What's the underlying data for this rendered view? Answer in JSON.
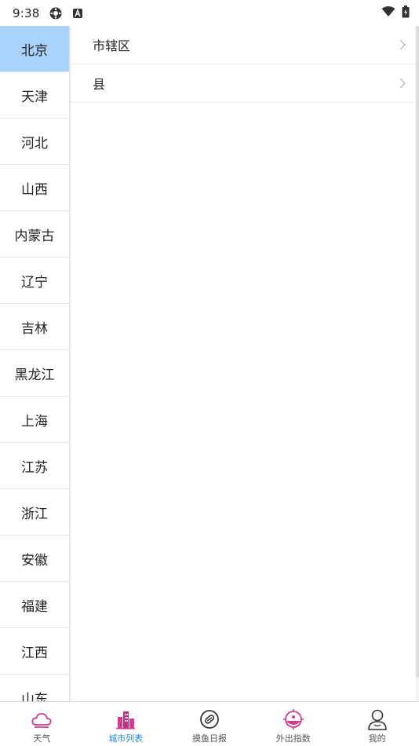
{
  "status_bar": {
    "time": "9:38"
  },
  "provinces": [
    {
      "label": "北京",
      "active": true
    },
    {
      "label": "天津"
    },
    {
      "label": "河北"
    },
    {
      "label": "山西"
    },
    {
      "label": "内蒙古"
    },
    {
      "label": "辽宁"
    },
    {
      "label": "吉林"
    },
    {
      "label": "黑龙江"
    },
    {
      "label": "上海"
    },
    {
      "label": "江苏"
    },
    {
      "label": "浙江"
    },
    {
      "label": "安徽"
    },
    {
      "label": "福建"
    },
    {
      "label": "江西"
    },
    {
      "label": "山东"
    }
  ],
  "cities": [
    {
      "label": "市辖区"
    },
    {
      "label": "县"
    }
  ],
  "tabs": [
    {
      "label": "天气",
      "icon": "cloud-icon"
    },
    {
      "label": "城市列表",
      "icon": "city-icon",
      "active": true
    },
    {
      "label": "摸鱼日报",
      "icon": "badge-icon"
    },
    {
      "label": "外出指数",
      "icon": "target-icon"
    },
    {
      "label": "我的",
      "icon": "profile-icon"
    }
  ],
  "colors": {
    "accent_pink": "#d63b8f",
    "active_tab_text": "#2a8ad8",
    "selected_province_bg": "#a9d3fb"
  }
}
